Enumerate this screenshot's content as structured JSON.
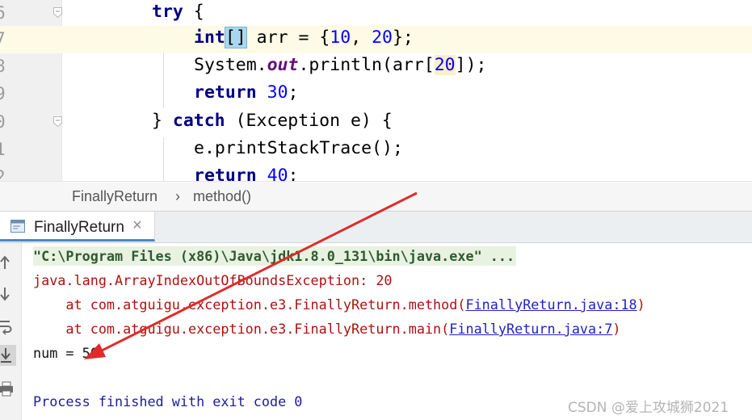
{
  "editor": {
    "lines": [
      {
        "num": "6"
      },
      {
        "num": "7"
      },
      {
        "num": "8"
      },
      {
        "num": "9"
      },
      {
        "num": "0"
      },
      {
        "num": "1"
      },
      {
        "num": "2"
      }
    ],
    "code": {
      "l1_kw": "try",
      "l1_rest": " {",
      "l2_kw": "int",
      "l2_bracket": "[]",
      "l2_a": " arr = {",
      "l2_n1": "10",
      "l2_b": ", ",
      "l2_n2": "20",
      "l2_c": "};",
      "l3_a": "System.",
      "l3_out": "out",
      "l3_b": ".println(arr[",
      "l3_n": "20",
      "l3_c": "]);",
      "l4_kw": "return",
      "l4_sp": " ",
      "l4_n": "30",
      "l4_c": ";",
      "l5_a": "} ",
      "l5_kw": "catch",
      "l5_b": " (Exception e) {",
      "l6": "e.printStackTrace();",
      "l7_kw": "return",
      "l7_sp": " ",
      "l7_n": "40",
      "l7_c": ";"
    }
  },
  "breadcrumb": {
    "class": "FinallyReturn",
    "separator": "›",
    "method": "method()"
  },
  "run_tab": {
    "label": "FinallyReturn",
    "close": "×"
  },
  "console": {
    "cmd": "\"C:\\Program Files (x86)\\Java\\jdk1.8.0_131\\bin\\java.exe\" ...",
    "exception": "java.lang.ArrayIndexOutOfBoundsException: 20",
    "at1_pre": "    at com.atguigu.exception.e3.FinallyReturn.method(",
    "at1_link": "FinallyReturn.java:18",
    "at1_post": ")",
    "at2_pre": "    at com.atguigu.exception.e3.FinallyReturn.main(",
    "at2_link": "FinallyReturn.java:7",
    "at2_post": ")",
    "output": "num = 50",
    "finished": "Process finished with exit code 0"
  },
  "watermark": "CSDN @爱上攻城狮2021",
  "colors": {
    "arrow": "#e02a2a",
    "tab_underline": "#4a88c7"
  },
  "icons": [
    "fold-marker-icon",
    "console-icon",
    "close-icon",
    "up-arrow-icon",
    "down-arrow-icon",
    "soft-wrap-icon",
    "scroll-to-end-icon",
    "print-icon"
  ]
}
